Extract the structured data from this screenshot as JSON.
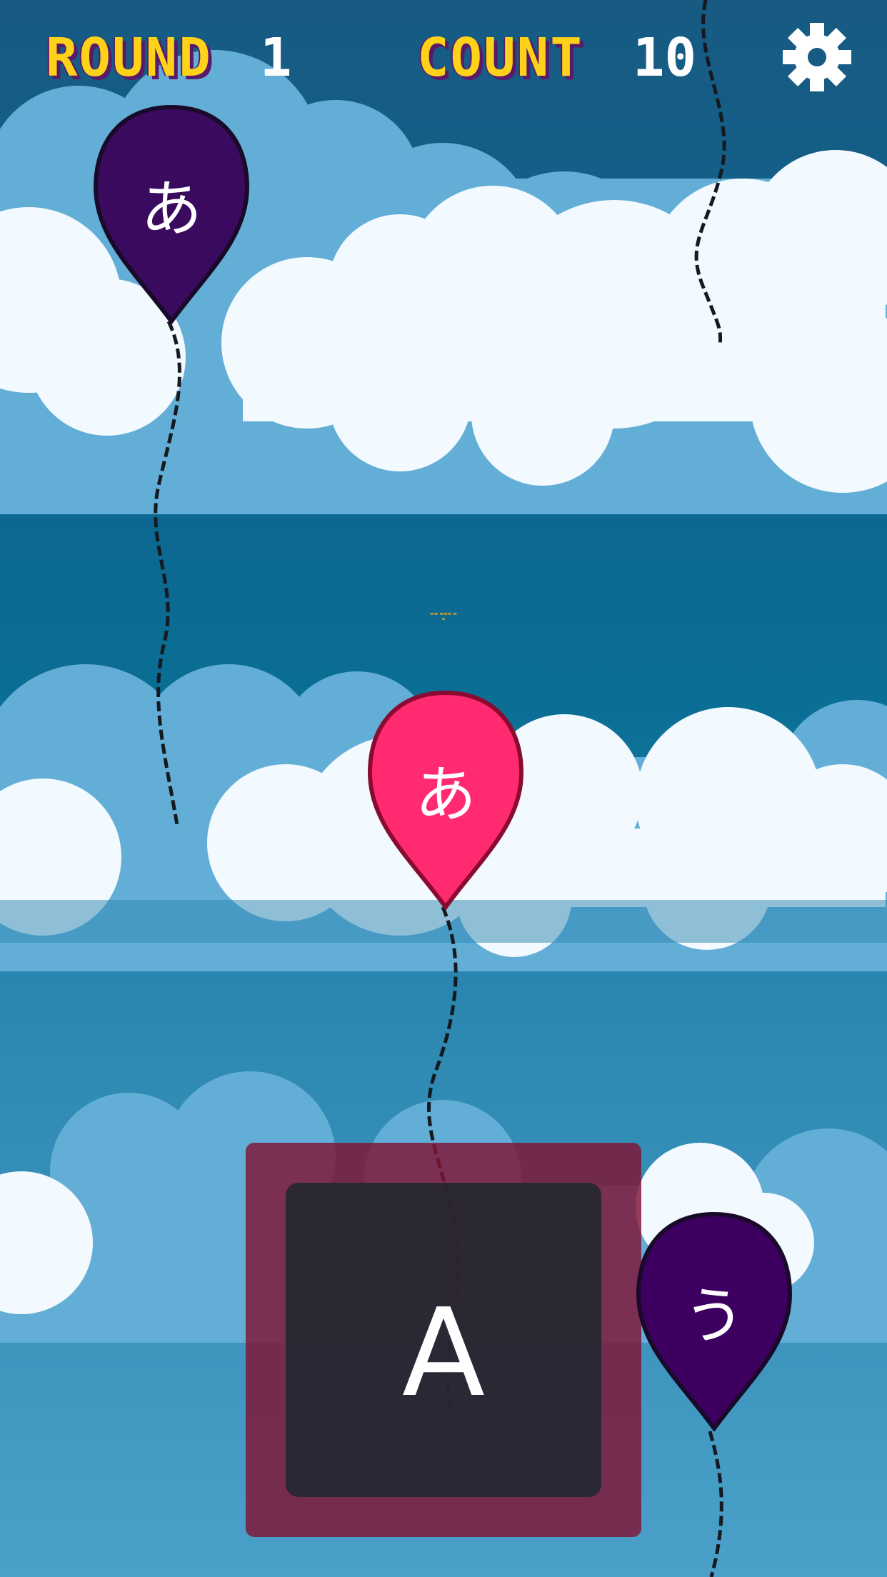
{
  "hud": {
    "round_label": "ROUND",
    "round_value": "1",
    "count_label": "COUNT",
    "count_value": "10",
    "settings_icon": "gear-icon"
  },
  "balloons": [
    {
      "glyph": "あ",
      "color": "#3a0a5e",
      "outline": "#1a0a2a"
    },
    {
      "glyph": "あ",
      "color": "#ff2a70",
      "outline": "#8a0a30"
    },
    {
      "glyph": "う",
      "color": "#3d0060",
      "outline": "#1a0a2a"
    }
  ],
  "answer": {
    "letter": "A"
  },
  "colors": {
    "hud_yellow": "#ffd21a",
    "hud_shadow": "#5a1a6a",
    "cloud_white": "#f2f9ff",
    "cloud_blue": "#63aed6"
  }
}
